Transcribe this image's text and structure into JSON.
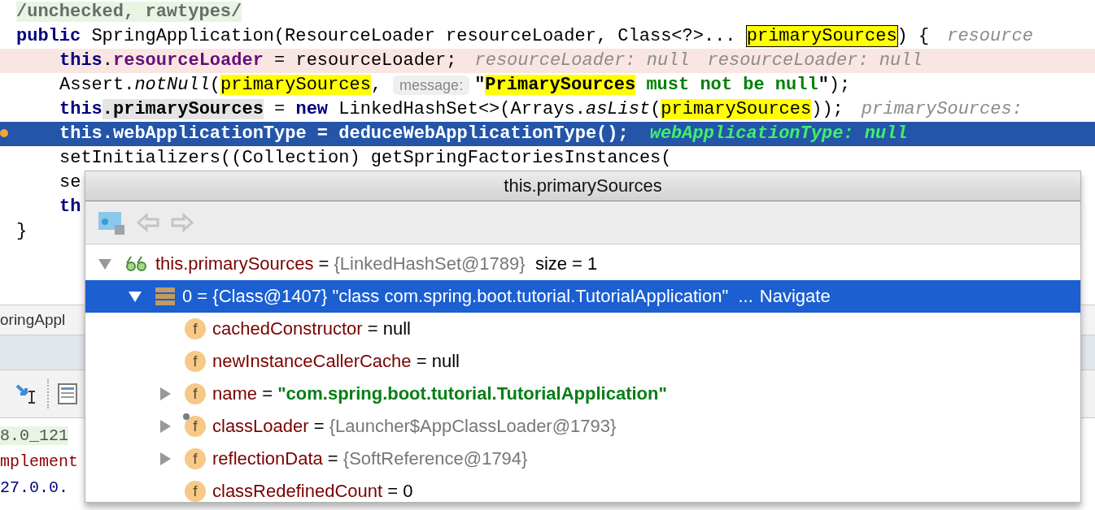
{
  "editor": {
    "lines": [
      {
        "indented": false,
        "modified": false,
        "current": false,
        "breakpoint": false,
        "tokens": [
          {
            "kind": "annotation",
            "text": "/unchecked, rawtypes/"
          }
        ]
      },
      {
        "indented": false,
        "modified": false,
        "current": false,
        "breakpoint": false,
        "tokens": [
          {
            "kind": "kw",
            "text": "public"
          },
          {
            "kind": "plain",
            "text": " SpringApplication(ResourceLoader resourceLoader, Class<?>... "
          },
          {
            "kind": "match-boxed",
            "text": "primarySources"
          },
          {
            "kind": "plain",
            "text": ") {"
          },
          {
            "kind": "hint",
            "text": "resource"
          }
        ]
      },
      {
        "indented": true,
        "modified": true,
        "current": false,
        "breakpoint": false,
        "tokens": [
          {
            "kind": "kw",
            "text": "this"
          },
          {
            "kind": "plain",
            "text": "."
          },
          {
            "kind": "field",
            "text": "resourceLoader"
          },
          {
            "kind": "plain",
            "text": " = resourceLoader;"
          },
          {
            "kind": "hint",
            "text": "resourceLoader: null"
          },
          {
            "kind": "hint",
            "text": "resourceLoader: null"
          }
        ]
      },
      {
        "indented": true,
        "modified": false,
        "current": false,
        "breakpoint": false,
        "tokens": [
          {
            "kind": "plain",
            "text": "Assert."
          },
          {
            "kind": "italic",
            "text": "notNull"
          },
          {
            "kind": "plain",
            "text": "("
          },
          {
            "kind": "match",
            "text": "primarySources"
          },
          {
            "kind": "plain",
            "text": ","
          },
          {
            "kind": "chip",
            "text": "message:"
          },
          {
            "kind": "bold",
            "text": "\""
          },
          {
            "kind": "match-bold",
            "text": "PrimarySources"
          },
          {
            "kind": "str",
            "text": " must not be null"
          },
          {
            "kind": "bold",
            "text": "\""
          },
          {
            "kind": "plain",
            "text": ");"
          }
        ]
      },
      {
        "indented": true,
        "modified": false,
        "current": false,
        "breakpoint": false,
        "tokens": [
          {
            "kind": "kw",
            "text": "this"
          },
          {
            "kind": "write",
            "text": ".primarySources"
          },
          {
            "kind": "plain",
            "text": " = "
          },
          {
            "kind": "kw",
            "text": "new"
          },
          {
            "kind": "plain",
            "text": " LinkedHashSet<>(Arrays."
          },
          {
            "kind": "italic",
            "text": "asList"
          },
          {
            "kind": "plain",
            "text": "("
          },
          {
            "kind": "match",
            "text": "primarySources"
          },
          {
            "kind": "plain",
            "text": "));"
          },
          {
            "kind": "hint",
            "text": "primarySources:"
          }
        ]
      },
      {
        "indented": true,
        "modified": false,
        "current": true,
        "breakpoint": true,
        "tokens": [
          {
            "kind": "plain",
            "text": "this.webApplicationType = deduceWebApplicationType();"
          },
          {
            "kind": "debug",
            "text": "webApplicationType: null"
          }
        ]
      },
      {
        "indented": true,
        "modified": false,
        "current": false,
        "breakpoint": false,
        "tokens": [
          {
            "kind": "plain",
            "text": "setInitializers((Collection) getSpringFactoriesInstances("
          }
        ]
      },
      {
        "indented": true,
        "modified": false,
        "current": false,
        "breakpoint": false,
        "tokens": [
          {
            "kind": "plain",
            "text": "se"
          }
        ]
      },
      {
        "indented": true,
        "modified": false,
        "current": false,
        "breakpoint": false,
        "tokens": [
          {
            "kind": "kw",
            "text": "th"
          }
        ]
      },
      {
        "indented": false,
        "modified": false,
        "current": false,
        "breakpoint": false,
        "tokens": [
          {
            "kind": "plain",
            "text": "}"
          }
        ]
      }
    ]
  },
  "tool_window": {
    "breadcrumb": "oringAppl",
    "console": [
      {
        "kind": "version",
        "text": "8.0_121"
      },
      {
        "kind": "error",
        "text": "mplement"
      },
      {
        "kind": "address",
        "text": "27.0.0."
      }
    ]
  },
  "popup": {
    "title": "this.primarySources",
    "tree": [
      {
        "kind": "watch",
        "name": "this.primarySources",
        "operator": "=",
        "value": {
          "kind": "object",
          "text": "{LinkedHashSet@1789}"
        },
        "extra": "size = 1",
        "expanded": true,
        "selected": false,
        "children": [
          {
            "kind": "element",
            "name": "0",
            "operator": "=",
            "value": {
              "text": "{Class@1407} \"class com.spring.boot.tutorial.TutorialApplication\""
            },
            "extra": "...",
            "link": "Navigate",
            "expanded": true,
            "selected": true,
            "children": [
              {
                "kind": "field",
                "badge": "f",
                "name": "cachedConstructor",
                "operator": "=",
                "value": {
                  "kind": "plain",
                  "text": "null"
                },
                "selected": false,
                "pinned": false
              },
              {
                "kind": "field",
                "badge": "f",
                "name": "newInstanceCallerCache",
                "operator": "=",
                "value": {
                  "kind": "plain",
                  "text": "null"
                },
                "selected": false,
                "pinned": false
              },
              {
                "kind": "field",
                "badge": "f",
                "name": "name",
                "operator": "=",
                "value": {
                  "kind": "string",
                  "text": "\"com.spring.boot.tutorial.TutorialApplication\""
                },
                "expanded": false,
                "selected": false,
                "pinned": false
              },
              {
                "kind": "field",
                "badge": "f",
                "name": "classLoader",
                "operator": "=",
                "value": {
                  "kind": "object",
                  "text": "{Launcher$AppClassLoader@1793}"
                },
                "expanded": false,
                "selected": false,
                "pinned": true
              },
              {
                "kind": "field",
                "badge": "f",
                "name": "reflectionData",
                "operator": "=",
                "value": {
                  "kind": "object",
                  "text": "{SoftReference@1794}"
                },
                "expanded": false,
                "selected": false,
                "pinned": false
              },
              {
                "kind": "field",
                "badge": "f",
                "name": "classRedefinedCount",
                "operator": "=",
                "value": {
                  "kind": "plain",
                  "text": "0"
                },
                "selected": false,
                "pinned": false
              }
            ]
          }
        ]
      }
    ]
  }
}
